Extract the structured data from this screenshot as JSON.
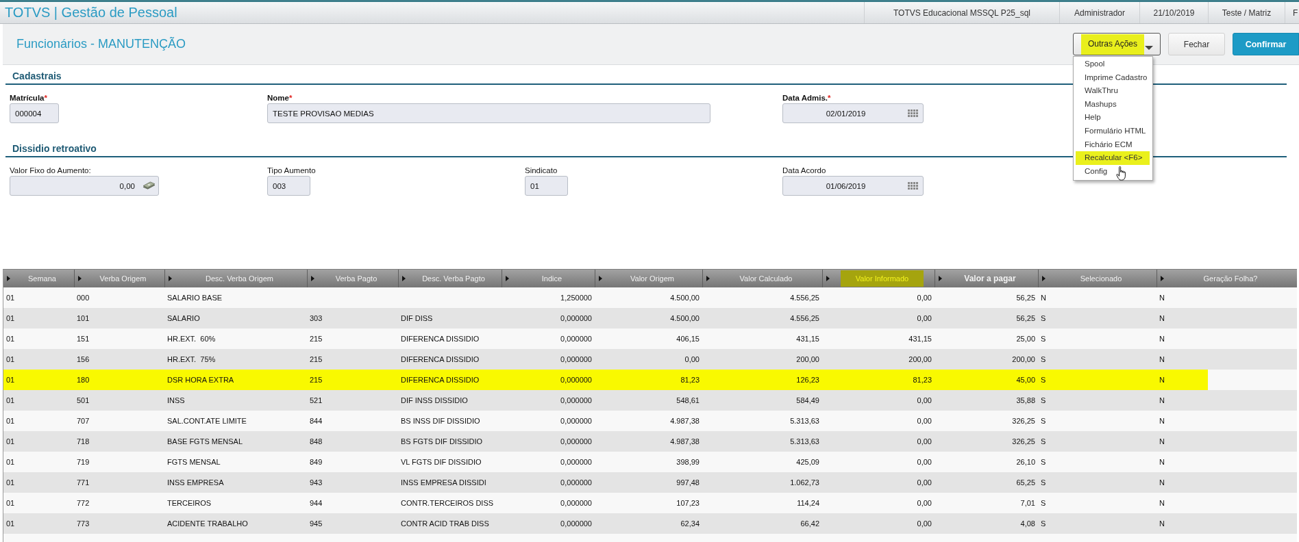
{
  "header": {
    "app_title": "TOTVS | Gestão de Pessoal",
    "info": [
      "TOTVS Educacional MSSQL P25_sql",
      "Administrador",
      "21/10/2019",
      "Teste / Matriz",
      "F"
    ]
  },
  "page": {
    "title": "Funcionários - MANUTENÇÃO",
    "actions": [
      {
        "kind": "menu",
        "label": "Outras Ações",
        "highlighted": true
      },
      {
        "kind": "secondary",
        "label": "Fechar",
        "highlighted": false
      },
      {
        "kind": "primary",
        "label": "Confirmar",
        "highlighted": false
      }
    ],
    "dropdown": {
      "expanded": true,
      "items": [
        {
          "label": "Spool",
          "highlighted": false
        },
        {
          "label": "Imprime Cadastro",
          "highlighted": false
        },
        {
          "label": "WalkThru",
          "highlighted": false
        },
        {
          "label": "Mashups",
          "highlighted": false
        },
        {
          "label": "Help",
          "highlighted": false
        },
        {
          "label": "Formulário HTML",
          "highlighted": false
        },
        {
          "label": "Fichário ECM",
          "highlighted": false
        },
        {
          "label": "Recalcular <F6>",
          "highlighted": true
        },
        {
          "label": "Config",
          "highlighted": false
        }
      ]
    }
  },
  "sections": [
    {
      "title": "Cadastrais",
      "fields": [
        {
          "label": "Matrícula",
          "required_mark": "*",
          "kind": "text",
          "value": "000004"
        },
        {
          "label": "Nome",
          "required_mark": "*",
          "kind": "text",
          "value": "TESTE PROVISAO MEDIAS"
        },
        {
          "label": "Data Admis.",
          "required_mark": "*",
          "kind": "date",
          "value": "02/01/2019"
        }
      ]
    },
    {
      "title": "Dissidio retroativo",
      "fields": [
        {
          "label": "Valor Fixo do Aumento:",
          "kind": "currency",
          "value": "0,00"
        },
        {
          "label": "Tipo Aumento",
          "kind": "text",
          "value": "003"
        },
        {
          "label": "Sindicato",
          "kind": "text",
          "value": "01"
        },
        {
          "label": "Data Acordo",
          "kind": "date",
          "value": "01/06/2019"
        }
      ]
    }
  ],
  "table": {
    "columns": [
      {
        "label": "Semana",
        "kind": "text",
        "bold": false,
        "highlighted": false
      },
      {
        "label": "Verba Origem",
        "kind": "text",
        "bold": false,
        "highlighted": false
      },
      {
        "label": "Desc. Verba Origem",
        "kind": "text",
        "bold": false,
        "highlighted": false
      },
      {
        "label": "Verba Pagto",
        "kind": "text",
        "bold": false,
        "highlighted": false
      },
      {
        "label": "Desc. Verba Pagto",
        "kind": "text",
        "bold": false,
        "highlighted": false
      },
      {
        "label": "Indice",
        "kind": "number",
        "bold": false,
        "highlighted": false
      },
      {
        "label": "Valor Origem",
        "kind": "number",
        "bold": false,
        "highlighted": false
      },
      {
        "label": "Valor Calculado",
        "kind": "number",
        "bold": false,
        "highlighted": false
      },
      {
        "label": "Valor Informado",
        "kind": "number",
        "bold": false,
        "highlighted": true
      },
      {
        "label": "Valor a pagar",
        "kind": "number",
        "bold": true,
        "highlighted": false
      },
      {
        "label": "Selecionado",
        "kind": "text",
        "bold": false,
        "highlighted": false
      },
      {
        "label": "Geração Folha?",
        "kind": "text",
        "bold": false,
        "highlighted": false
      }
    ],
    "rows": [
      {
        "highlighted": false,
        "cells": [
          "01",
          "000",
          "SALARIO BASE",
          null,
          null,
          "1,250000",
          "4.500,00",
          "4.556,25",
          "0,00",
          "56,25",
          "N",
          "N"
        ]
      },
      {
        "highlighted": false,
        "cells": [
          "01",
          "101",
          "SALARIO",
          "303",
          "DIF DISS",
          "0,000000",
          "4.500,00",
          "4.556,25",
          "0,00",
          "56,25",
          "S",
          "N"
        ]
      },
      {
        "highlighted": false,
        "cells": [
          "01",
          "151",
          "HR.EXT.  60%",
          "215",
          "DIFERENCA DISSIDIO",
          "0,000000",
          "406,15",
          "431,15",
          "431,15",
          "25,00",
          "S",
          "N"
        ]
      },
      {
        "highlighted": false,
        "cells": [
          "01",
          "156",
          "HR.EXT.  75%",
          "215",
          "DIFERENCA DISSIDIO",
          "0,000000",
          "0,00",
          "200,00",
          "200,00",
          "200,00",
          "S",
          "N"
        ]
      },
      {
        "highlighted": true,
        "cells": [
          "01",
          "180",
          "DSR HORA EXTRA",
          "215",
          "DIFERENCA DISSIDIO",
          "0,000000",
          "81,23",
          "126,23",
          "81,23",
          "45,00",
          "S",
          "N"
        ]
      },
      {
        "highlighted": false,
        "cells": [
          "01",
          "501",
          "INSS",
          "521",
          "DIF INSS DISSIDIO",
          "0,000000",
          "548,61",
          "584,49",
          "0,00",
          "35,88",
          "S",
          "N"
        ]
      },
      {
        "highlighted": false,
        "cells": [
          "01",
          "707",
          "SAL.CONT.ATE LIMITE",
          "844",
          "BS INSS DIF DISSIDIO",
          "0,000000",
          "4.987,38",
          "5.313,63",
          "0,00",
          "326,25",
          "S",
          "N"
        ]
      },
      {
        "highlighted": false,
        "cells": [
          "01",
          "718",
          "BASE FGTS MENSAL",
          "848",
          "BS FGTS DIF DISSIDIO",
          "0,000000",
          "4.987,38",
          "5.313,63",
          "0,00",
          "326,25",
          "S",
          "N"
        ]
      },
      {
        "highlighted": false,
        "cells": [
          "01",
          "719",
          "FGTS MENSAL",
          "849",
          "VL FGTS DIF DISSIDIO",
          "0,000000",
          "398,99",
          "425,09",
          "0,00",
          "26,10",
          "S",
          "N"
        ]
      },
      {
        "highlighted": false,
        "cells": [
          "01",
          "771",
          "INSS EMPRESA",
          "943",
          "INSS EMPRESA DISSIDI",
          "0,000000",
          "997,48",
          "1.062,73",
          "0,00",
          "65,25",
          "S",
          "N"
        ]
      },
      {
        "highlighted": false,
        "cells": [
          "01",
          "772",
          "TERCEIROS",
          "944",
          "CONTR.TERCEIROS DISS",
          "0,000000",
          "107,23",
          "114,24",
          "0,00",
          "7,01",
          "S",
          "N"
        ]
      },
      {
        "highlighted": false,
        "cells": [
          "01",
          "773",
          "ACIDENTE TRABALHO",
          "945",
          "CONTR ACID TRAB DISS",
          "0,000000",
          "62,34",
          "66,42",
          "0,00",
          "4,08",
          "S",
          "N"
        ]
      }
    ]
  }
}
